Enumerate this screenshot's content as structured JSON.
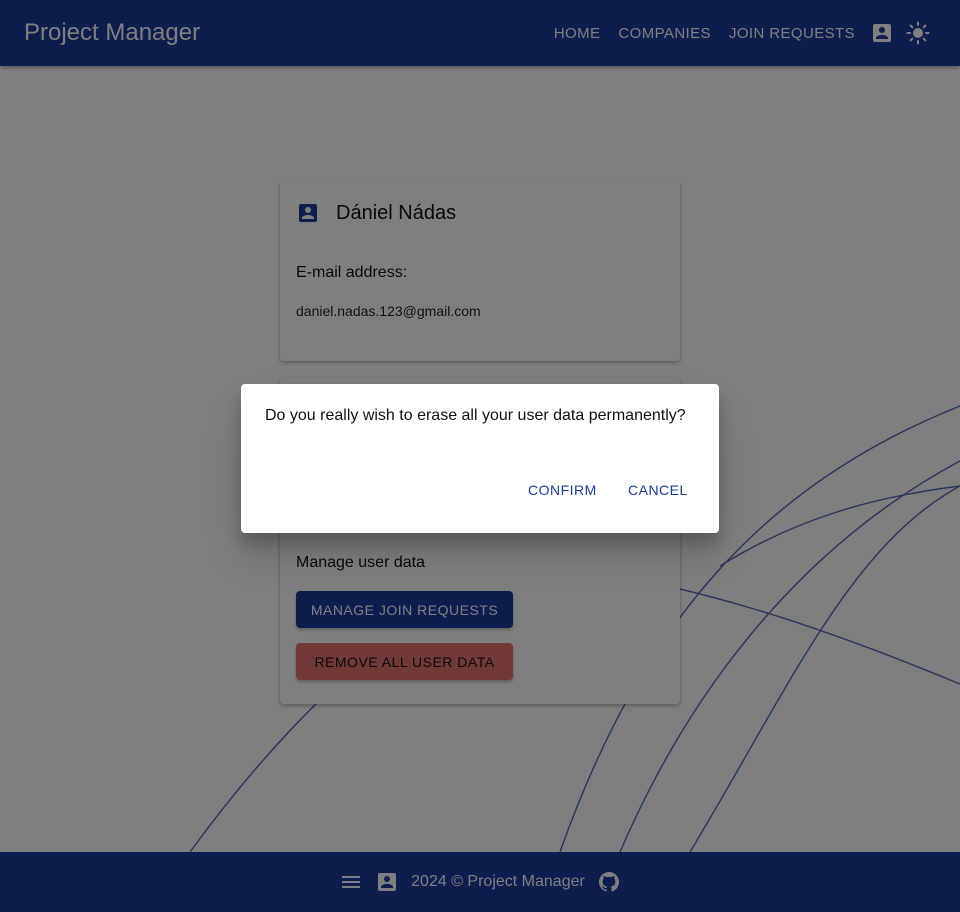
{
  "header": {
    "title": "Project Manager",
    "nav": [
      "HOME",
      "COMPANIES",
      "JOIN REQUESTS"
    ],
    "icons": [
      "account-box-icon",
      "sun-icon"
    ]
  },
  "profile": {
    "name": "Dániel Nádas",
    "email_label": "E-mail address:",
    "email": "daniel.nadas.123@gmail.com"
  },
  "manage": {
    "label": "Manage user data",
    "join_requests_button": "MANAGE JOIN REQUESTS",
    "remove_button": "REMOVE ALL USER DATA"
  },
  "dialog": {
    "message": "Do you really wish to erase all your user data permanently?",
    "confirm": "CONFIRM",
    "cancel": "CANCEL"
  },
  "footer": {
    "text": "2024 © Project Manager",
    "icons": [
      "menu-icon",
      "account-box-icon",
      "github-icon"
    ]
  },
  "colors": {
    "primary": "#1a3a9c",
    "danger": "#e57373"
  }
}
